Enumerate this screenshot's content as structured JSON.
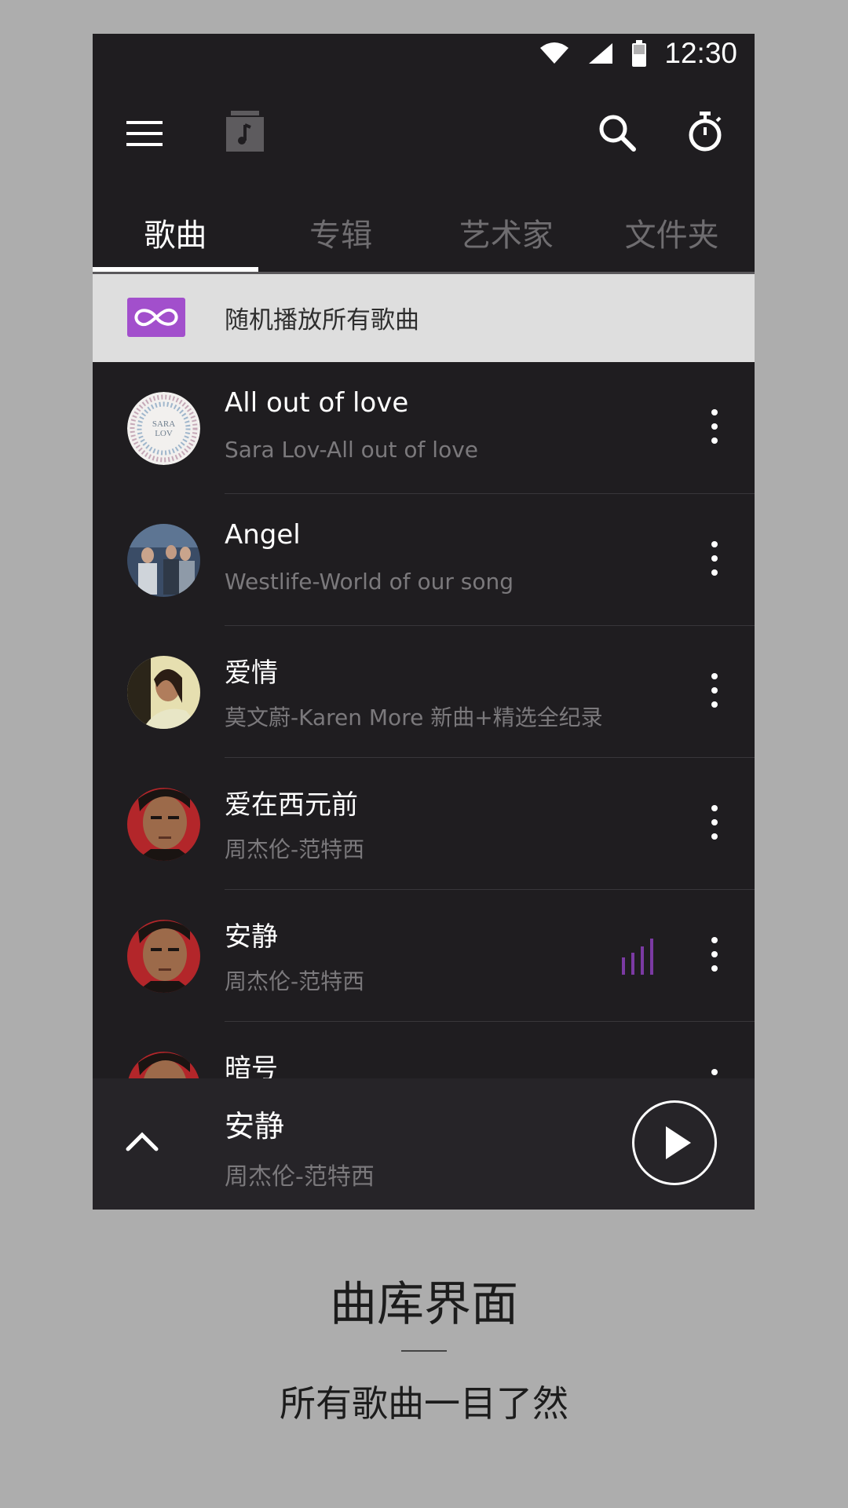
{
  "status_bar": {
    "time": "12:30",
    "icons": [
      "wifi-icon",
      "signal-icon",
      "battery-icon"
    ]
  },
  "toolbar": {
    "icons": [
      "menu-icon",
      "music-library-icon",
      "search-icon",
      "timer-icon"
    ]
  },
  "tabs": [
    {
      "label": "歌曲",
      "active": true
    },
    {
      "label": "专辑",
      "active": false
    },
    {
      "label": "艺术家",
      "active": false
    },
    {
      "label": "文件夹",
      "active": false
    }
  ],
  "shuffle": {
    "label": "随机播放所有歌曲",
    "icon": "shuffle-infinity-icon",
    "icon_color": "#a24fcc"
  },
  "songs": [
    {
      "title": "All out of love",
      "subtitle": "Sara Lov-All out of love",
      "playing": false
    },
    {
      "title": "Angel",
      "subtitle": "Westlife-World of our song",
      "playing": false
    },
    {
      "title": "爱情",
      "subtitle": "莫文蔚-Karen More 新曲+精选全纪录",
      "playing": false
    },
    {
      "title": "爱在西元前",
      "subtitle": "周杰伦-范特西",
      "playing": false
    },
    {
      "title": "安静",
      "subtitle": "周杰伦-范特西",
      "playing": true
    },
    {
      "title": "暗号",
      "subtitle": "",
      "playing": false
    }
  ],
  "now_playing": {
    "title": "安静",
    "subtitle": "周杰伦-范特西"
  },
  "caption": {
    "title": "曲库界面",
    "subtitle": "所有歌曲一目了然"
  },
  "colors": {
    "background": "#1f1d20",
    "accent": "#a24fcc",
    "page_bg": "#adadad"
  }
}
